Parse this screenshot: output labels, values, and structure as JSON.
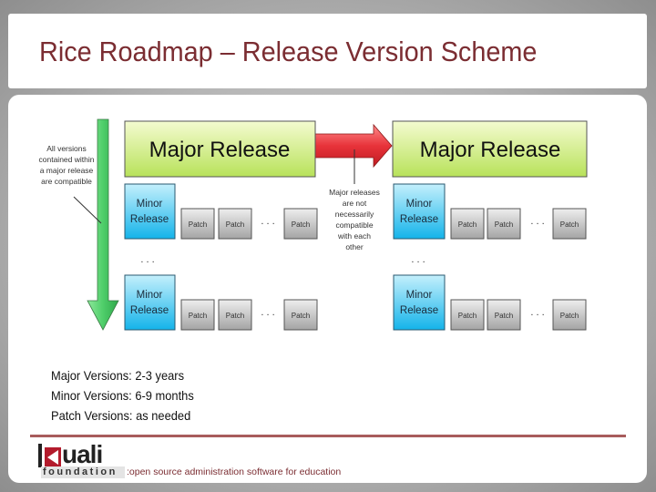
{
  "slide": {
    "title": "Rice Roadmap – Release Version Scheme"
  },
  "diagram": {
    "major_release_label": "Major Release",
    "minor_release_label_line1": "Minor",
    "minor_release_label_line2": "Release",
    "patch_label": "Patch",
    "ellipsis": ". . .",
    "left_note": [
      "All versions",
      "contained within",
      "a major release",
      "are compatible"
    ],
    "middle_note": [
      "Major releases",
      "are not",
      "necessarily",
      "compatible",
      "with each",
      "other"
    ],
    "colors": {
      "major_fill_top": "#f4fbd0",
      "major_fill_bottom": "#b8e25a",
      "minor_fill_top": "#b8ecfb",
      "minor_fill_bottom": "#1ab6ea",
      "patch_fill_top": "#e8e8e8",
      "patch_fill_bottom": "#a9a9a9",
      "red_arrow": "#e8333a",
      "green_arrow": "#4fce6a"
    }
  },
  "bullets": [
    "Major Versions: 2-3 years",
    "Minor Versions: 6-9 months",
    "Patch Versions: as needed"
  ],
  "footer": {
    "logo_word": "uali",
    "logo_foundation": "foundation",
    "tagline": ":open source administration software for education"
  }
}
